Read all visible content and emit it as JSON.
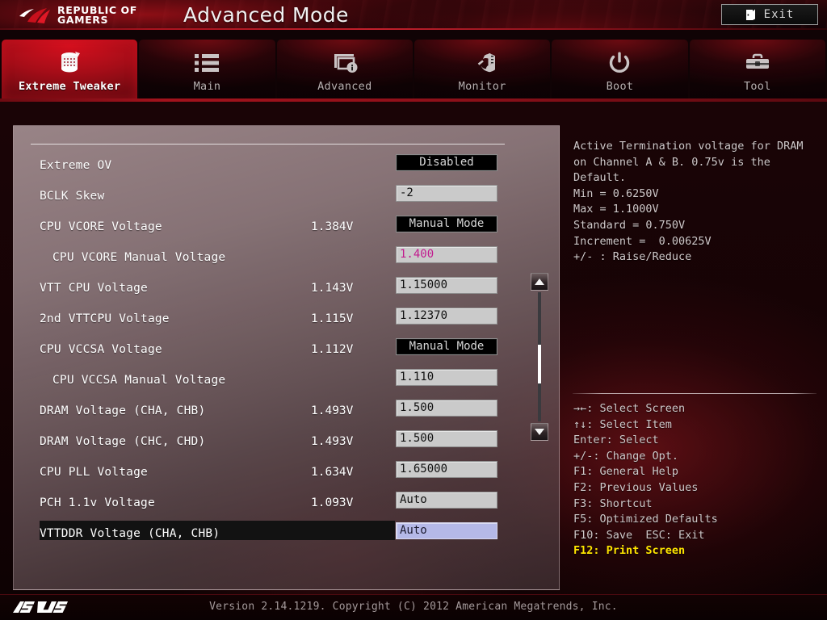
{
  "banner": {
    "brand_line1": "REPUBLIC OF",
    "brand_line2": "GAMERS",
    "title": "Advanced Mode",
    "exit_label": "Exit"
  },
  "tabs": [
    {
      "label": "Extreme Tweaker",
      "icon": "tweaker-icon",
      "active": true
    },
    {
      "label": "Main",
      "icon": "list-icon",
      "active": false
    },
    {
      "label": "Advanced",
      "icon": "monitor-info-icon",
      "active": false
    },
    {
      "label": "Monitor",
      "icon": "gauge-thermometer-icon",
      "active": false
    },
    {
      "label": "Boot",
      "icon": "power-icon",
      "active": false
    },
    {
      "label": "Tool",
      "icon": "toolbox-icon",
      "active": false
    }
  ],
  "settings": [
    {
      "label": "Extreme OV",
      "indent": false,
      "current": "",
      "field": "Disabled",
      "field_type": "combo",
      "selected": false
    },
    {
      "label": "BCLK Skew",
      "indent": false,
      "current": "",
      "field": "-2",
      "field_type": "input",
      "selected": false
    },
    {
      "label": "CPU VCORE Voltage",
      "indent": false,
      "current": "1.384V",
      "field": "Manual Mode",
      "field_type": "combo",
      "selected": false
    },
    {
      "label": "CPU VCORE Manual Voltage",
      "indent": true,
      "current": "",
      "field": "1.400",
      "field_type": "accent",
      "selected": false
    },
    {
      "label": "VTT CPU Voltage",
      "indent": false,
      "current": "1.143V",
      "field": "1.15000",
      "field_type": "input",
      "selected": false
    },
    {
      "label": "2nd VTTCPU Voltage",
      "indent": false,
      "current": "1.115V",
      "field": "1.12370",
      "field_type": "input",
      "selected": false
    },
    {
      "label": "CPU VCCSA Voltage",
      "indent": false,
      "current": "1.112V",
      "field": "Manual Mode",
      "field_type": "combo",
      "selected": false
    },
    {
      "label": "CPU VCCSA Manual Voltage",
      "indent": true,
      "current": "",
      "field": "1.110",
      "field_type": "input",
      "selected": false
    },
    {
      "label": "DRAM Voltage (CHA, CHB)",
      "indent": false,
      "current": "1.493V",
      "field": "1.500",
      "field_type": "input",
      "selected": false
    },
    {
      "label": "DRAM Voltage (CHC, CHD)",
      "indent": false,
      "current": "1.493V",
      "field": "1.500",
      "field_type": "input",
      "selected": false
    },
    {
      "label": "CPU PLL Voltage",
      "indent": false,
      "current": "1.634V",
      "field": "1.65000",
      "field_type": "input",
      "selected": false
    },
    {
      "label": "PCH 1.1v Voltage",
      "indent": false,
      "current": "1.093V",
      "field": "Auto",
      "field_type": "input",
      "selected": false
    },
    {
      "label": "VTTDDR Voltage (CHA, CHB)",
      "indent": false,
      "current": "",
      "field": "Auto",
      "field_type": "sel",
      "selected": true
    }
  ],
  "scrollbar": {
    "up_arrow": "scroll-up-arrow",
    "down_arrow": "scroll-down-arrow",
    "thumb_position_percent": 58
  },
  "help": {
    "description": "Active Termination voltage for DRAM\non Channel A & B. 0.75v is the\nDefault.\nMin = 0.6250V\nMax = 1.1000V\nStandard = 0.750V\nIncrement =  0.00625V\n+/- : Raise/Reduce",
    "keys": [
      {
        "text": "→←: Select Screen",
        "highlight": false
      },
      {
        "text": "↑↓: Select Item",
        "highlight": false
      },
      {
        "text": "Enter: Select",
        "highlight": false
      },
      {
        "text": "+/-: Change Opt.",
        "highlight": false
      },
      {
        "text": "F1: General Help",
        "highlight": false
      },
      {
        "text": "F2: Previous Values",
        "highlight": false
      },
      {
        "text": "F3: Shortcut",
        "highlight": false
      },
      {
        "text": "F5: Optimized Defaults",
        "highlight": false
      },
      {
        "text": "F10: Save  ESC: Exit",
        "highlight": false
      },
      {
        "text": "F12: Print Screen",
        "highlight": true
      }
    ]
  },
  "footer": {
    "brand": "ASUS",
    "version": "Version 2.14.1219. Copyright (C) 2012 American Megatrends, Inc."
  },
  "colors": {
    "rog_red": "#c2101c",
    "accent_magenta": "#c21a8e",
    "highlight_yellow": "#ffe600",
    "selected_field_blue": "#b5b9e8",
    "panel_gray": "#a69294"
  }
}
